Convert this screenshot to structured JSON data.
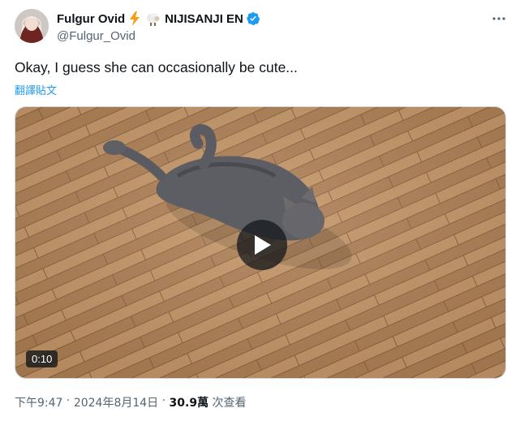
{
  "author": {
    "display_name": "Fulgur Ovid",
    "org_name": "NIJISANJI EN",
    "handle": "@Fulgur_Ovid",
    "emoji_icons": [
      "lightning-icon",
      "sheep-icon"
    ],
    "verified": true
  },
  "tweet": {
    "text": "Okay, I guess she can occasionally be cute...",
    "translate_label": "翻譯貼文"
  },
  "media": {
    "type": "video",
    "duration": "0:10"
  },
  "meta": {
    "time": "下午9:47",
    "separator": " · ",
    "date": "2024年8月14日",
    "views_count": "30.9萬",
    "views_label": " 次查看"
  },
  "colors": {
    "accent": "#1d9bf0",
    "text_primary": "#0f1419",
    "text_secondary": "#536471",
    "lightning": "#f4a017"
  }
}
